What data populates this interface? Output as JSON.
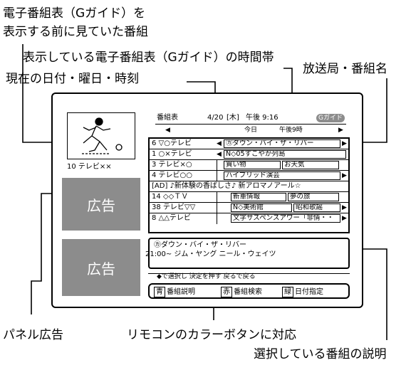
{
  "callouts": {
    "previous_program": [
      "電子番組表（Gガイド）を",
      "表示する前に見ていた番組"
    ],
    "time_range": "表示している電子番組表（Gガイド）の時間帯",
    "current_datetime": "現在の日付・曜日・時刻",
    "station_program": "放送局・番組名",
    "panel_ad": "パネル広告",
    "color_buttons": "リモコンのカラーボタンに対応",
    "selected_description": "選択している番組の説明"
  },
  "screen": {
    "header_title": "番組表",
    "date": "4/20",
    "weekday": "[木]",
    "time": "午後 9:16",
    "logo": "Gガイド",
    "nav_today": "今日",
    "nav_time": "午後9時",
    "current_channel": "10 テレビ××",
    "ad_label_1": "広告",
    "ad_label_2": "広告",
    "rows": [
      {
        "station": "6 ▽○テレビ",
        "programs": [
          "㋕ダウン・バイ・ザ・リバー"
        ]
      },
      {
        "station": "1 ○×テレビ",
        "programs": [
          "N◇05すこやか列島"
        ]
      },
      {
        "station": "3 テレビ×○",
        "programs": [
          "買い物",
          "お天気"
        ]
      },
      {
        "station": "4 テレビ○○",
        "programs": [
          "ハイブリッド演芸"
        ]
      },
      {
        "station": "[AD] ♪新体験の香ばしさ♪ 新アロマノアール☆",
        "programs": []
      },
      {
        "station": "14 ◇◇ＴＶ",
        "programs": [
          "新車情報",
          "夢の旅"
        ]
      },
      {
        "station": "38 テレビ▽▽",
        "programs": [
          "N◇美術館",
          "昭和歌謡"
        ]
      },
      {
        "station": "8 △△テレビ",
        "programs": [
          "文字サスペンスアワー「非情・・"
        ]
      }
    ],
    "desc_title": "㋕ダウン・バイ・ザ・リバー",
    "desc_line": "21:00~ ジム・ヤング ニール・ウェイツ",
    "nav_hint": "◆で選択し 決定を押す 戻るで戻る",
    "color_buttons": [
      {
        "tag": "青",
        "label": "番組説明"
      },
      {
        "tag": "赤",
        "label": "番組検索"
      },
      {
        "tag": "緑",
        "label": "日付指定"
      }
    ]
  }
}
